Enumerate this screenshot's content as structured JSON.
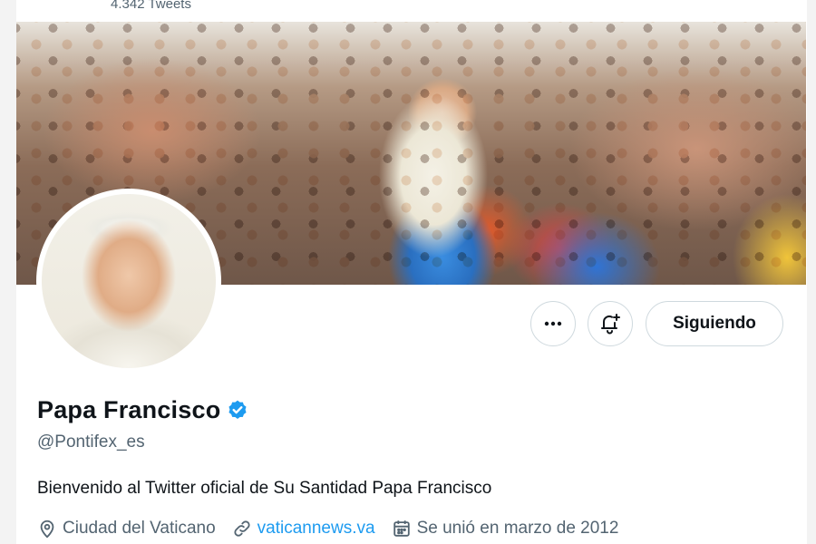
{
  "profile_header": {
    "tweets_count": "4.342 Tweets"
  },
  "profile": {
    "name": "Papa Francisco",
    "verified": true,
    "handle": "@Pontifex_es",
    "bio": "Bienvenido al Twitter oficial de Su Santidad Papa Francisco",
    "location": "Ciudad del Vaticano",
    "website": "vaticannews.va",
    "joined": "Se unió en marzo de 2012"
  },
  "actions": {
    "more_icon": "ellipsis-icon",
    "notify_icon": "bell-plus-icon",
    "following_label": "Siguiendo"
  },
  "colors": {
    "accent": "#1d9bf0",
    "text": "#0f1419",
    "secondary_text": "#536471",
    "border": "#cfd9de"
  }
}
